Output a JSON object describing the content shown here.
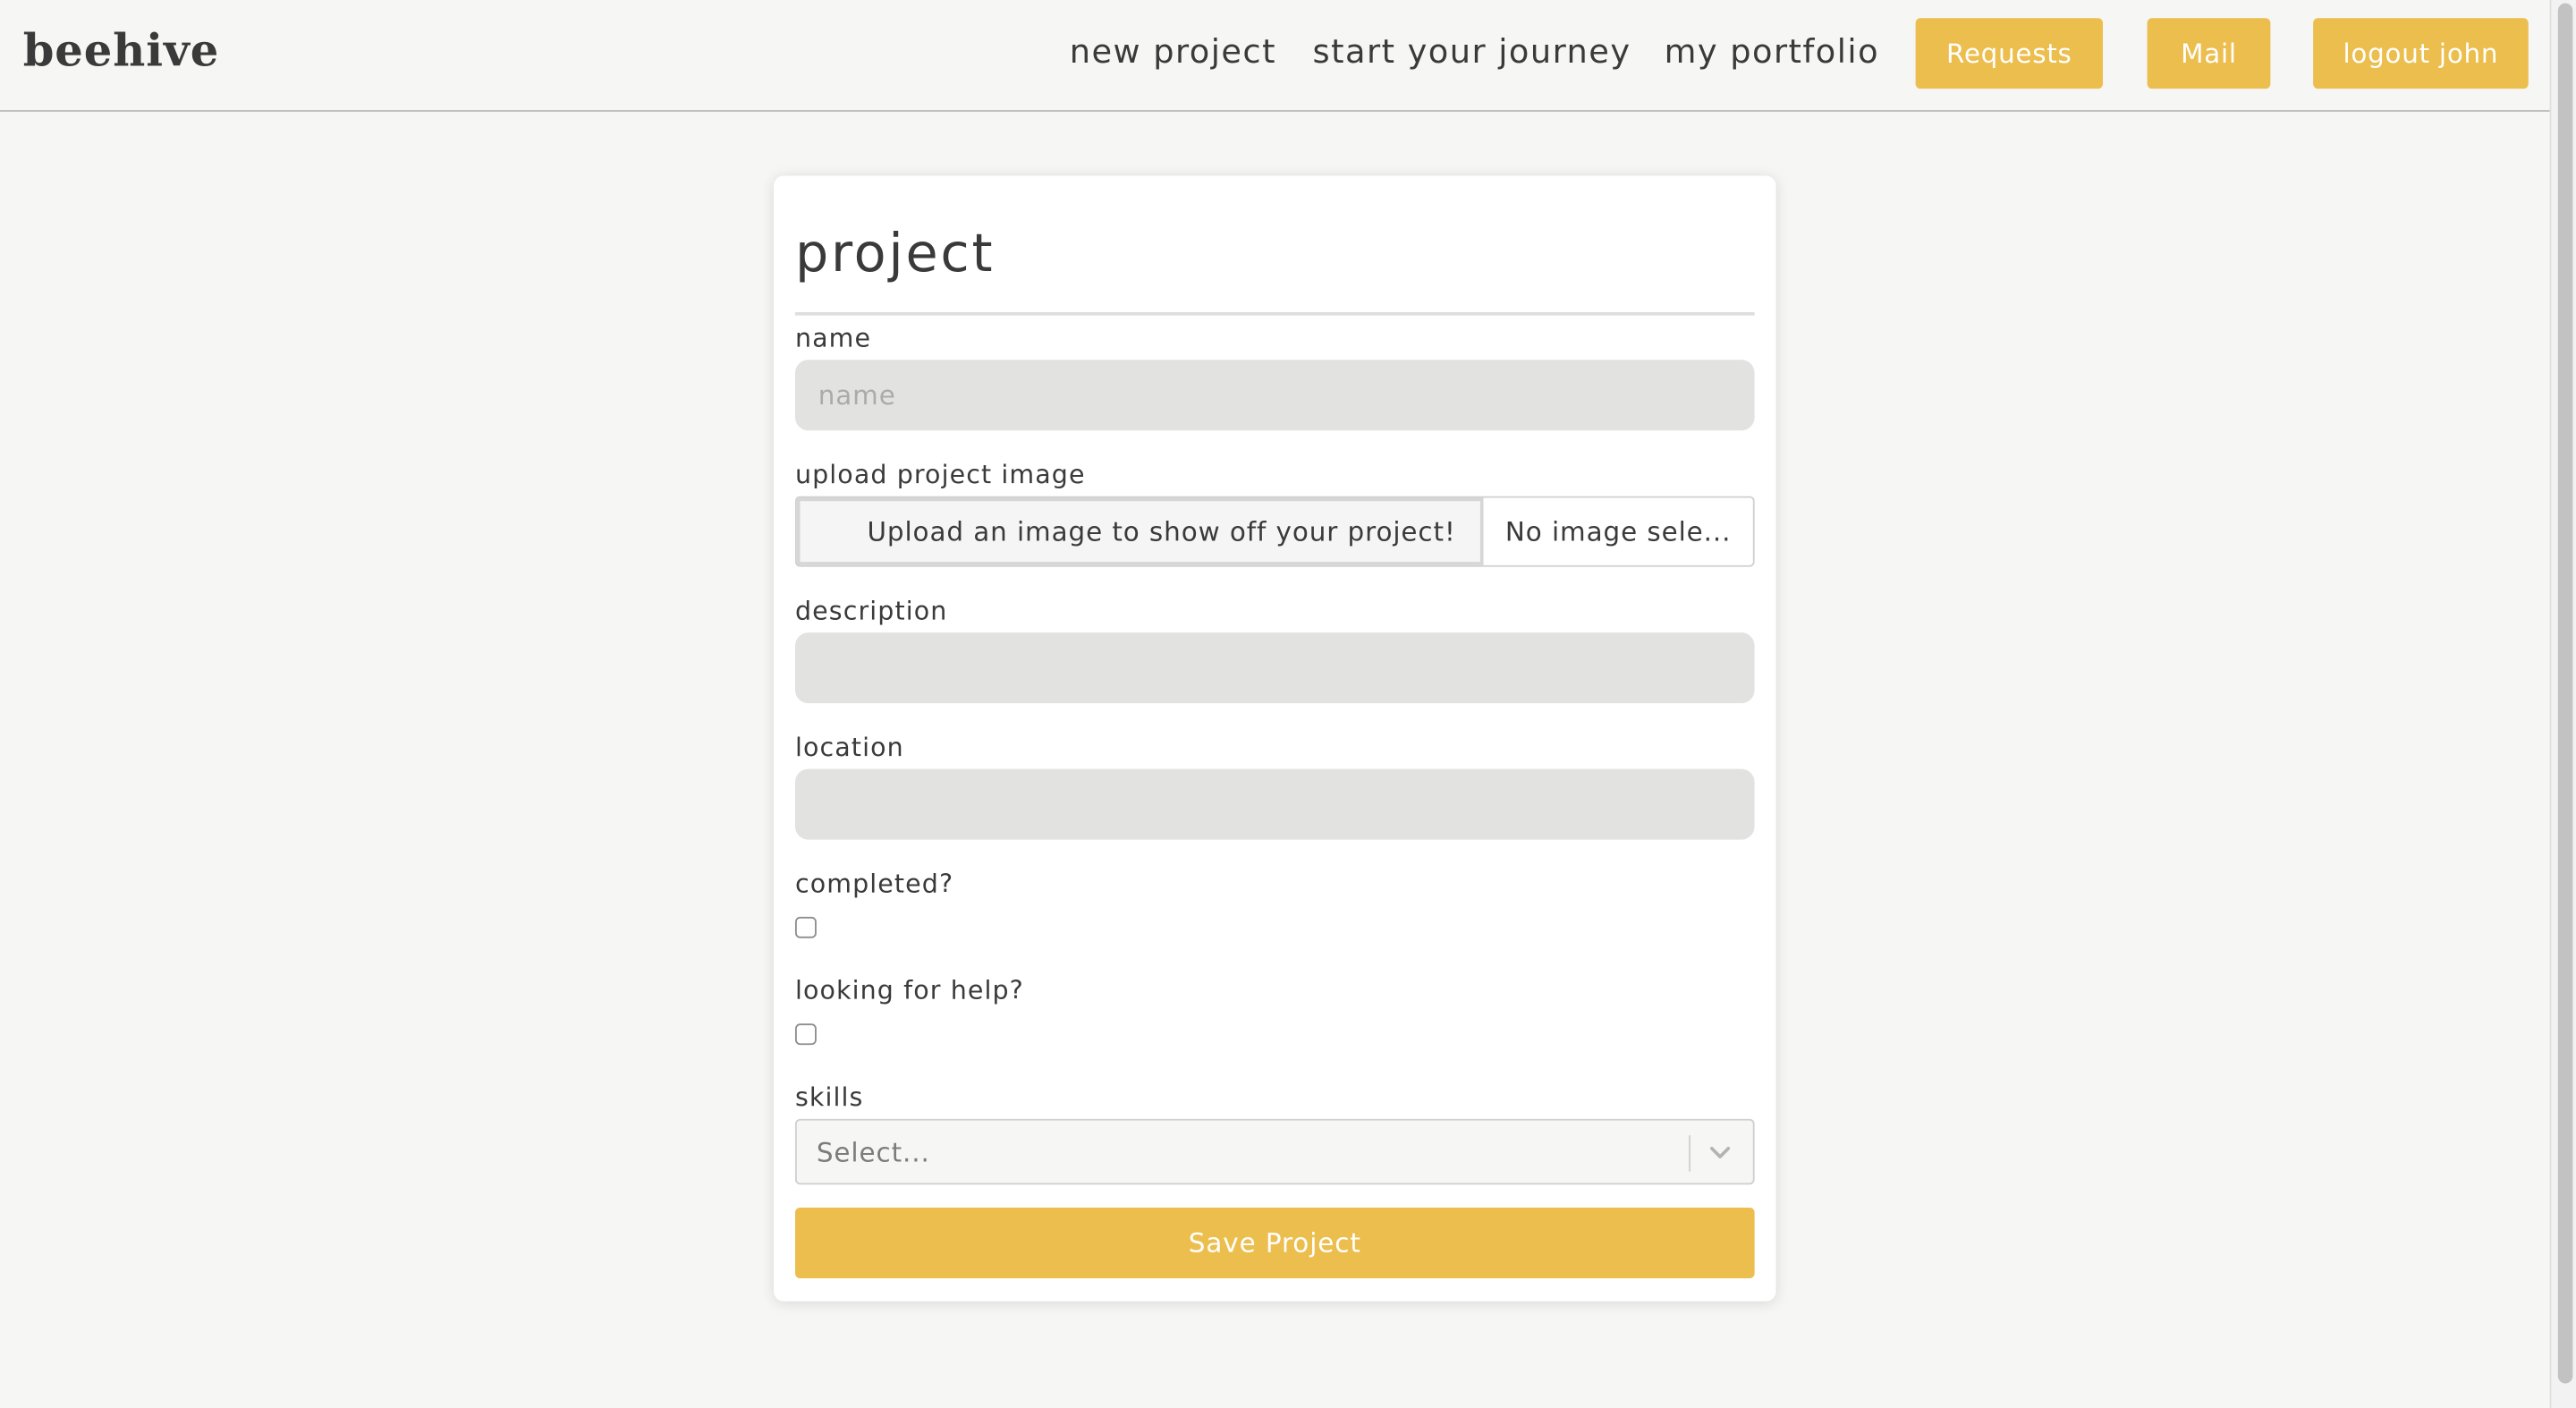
{
  "navbar": {
    "brand": "beehive",
    "links": [
      "new project",
      "start your journey",
      "my portfolio"
    ],
    "buttons": [
      "Requests",
      "Mail",
      "logout john"
    ]
  },
  "form": {
    "title": "project",
    "name": {
      "label": "name",
      "placeholder": "name",
      "value": ""
    },
    "image": {
      "label": "upload project image",
      "button": "Upload an image to show off your project!",
      "status": "No image sele..."
    },
    "description": {
      "label": "description",
      "value": ""
    },
    "location": {
      "label": "location",
      "value": ""
    },
    "completed": {
      "label": "completed?",
      "checked": false
    },
    "looking_for_help": {
      "label": "looking for help?",
      "checked": false
    },
    "skills": {
      "label": "skills",
      "placeholder": "Select..."
    },
    "save": "Save Project"
  },
  "colors": {
    "accent": "#ecbe4e",
    "background": "#f6f6f4",
    "input_fill": "#e2e2e1"
  }
}
